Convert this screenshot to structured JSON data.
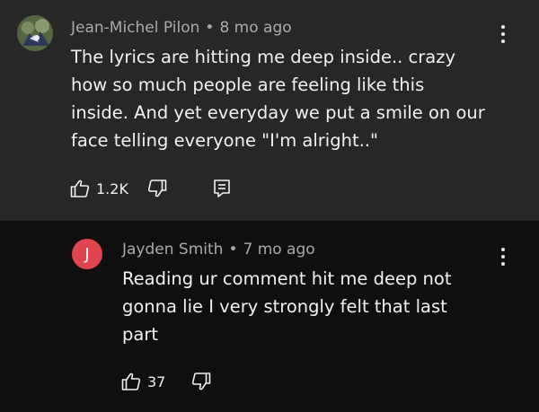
{
  "comments": [
    {
      "author": "Jean-Michel Pilon",
      "time": "8 mo ago",
      "lines": [
        "The lyrics are hitting me deep inside.. crazy",
        "how so much people are feeling like this",
        "inside. And yet everyday we put a smile on our",
        "face telling everyone \"I'm alright..\""
      ],
      "likes": "1.2K",
      "avatar_icon": "photo-avatar"
    },
    {
      "author": "Jayden Smith",
      "time": "7 mo ago",
      "avatar_letter": "J",
      "avatar_color": "#e0454f",
      "lines": [
        "Reading ur comment hit me deep not",
        "gonna lie I very strongly felt that last",
        "part"
      ],
      "likes": "37"
    }
  ],
  "meta_separator": "•",
  "colors": {
    "top_background": "#272727",
    "reply_background": "#0f0f0f",
    "text": "#f1f1f1",
    "meta": "#aaaaaa"
  }
}
